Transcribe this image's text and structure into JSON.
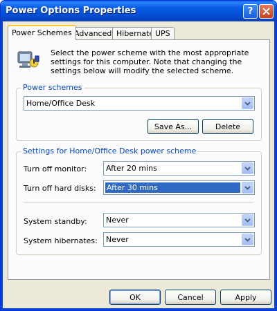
{
  "window": {
    "title": "Power Options Properties"
  },
  "tabs": [
    {
      "label": "Power Schemes",
      "active": true
    },
    {
      "label": "Advanced",
      "active": false
    },
    {
      "label": "Hibernate",
      "active": false
    },
    {
      "label": "UPS",
      "active": false
    }
  ],
  "intro": {
    "text": "Select the power scheme with the most appropriate settings for this computer. Note that changing the settings below will modify the selected scheme."
  },
  "power_schemes": {
    "group_title": "Power schemes",
    "selected": "Home/Office Desk",
    "save_as_label": "Save As...",
    "delete_label": "Delete"
  },
  "settings": {
    "group_title": "Settings for Home/Office Desk power scheme",
    "turn_off_monitor": {
      "label": "Turn off monitor:",
      "value": "After 20 mins"
    },
    "turn_off_hard_disks": {
      "label": "Turn off hard disks:",
      "value": "After 30 mins"
    },
    "system_standby": {
      "label": "System standby:",
      "value": "Never"
    },
    "system_hibernates": {
      "label": "System hibernates:",
      "value": "Never"
    }
  },
  "footer": {
    "ok_label": "OK",
    "cancel_label": "Cancel",
    "apply_label": "Apply"
  },
  "colors": {
    "title_bar": "#0a5fe6",
    "group_title": "#0046d5",
    "selection": "#316ac5",
    "active_tab_highlight": "#ffc83c"
  },
  "icons": {
    "help": "help-icon",
    "close": "close-icon",
    "power": "power-options-icon",
    "dropdown": "chevron-down-icon"
  }
}
